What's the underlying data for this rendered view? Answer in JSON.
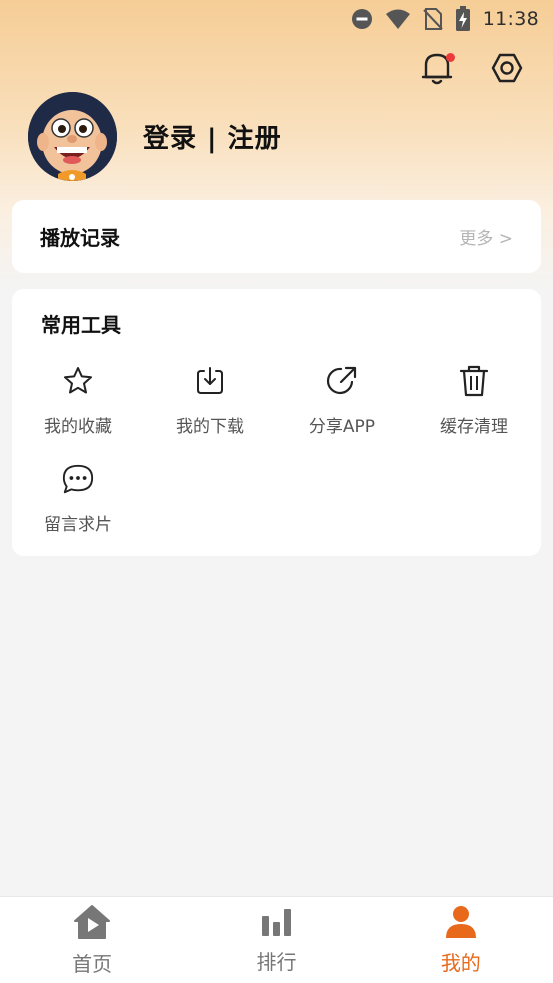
{
  "status_bar": {
    "time": "11:38",
    "icons": [
      "dnd-icon",
      "wifi-icon",
      "no-sim-icon",
      "battery-charging-icon"
    ]
  },
  "header": {
    "icons": [
      "bell-icon",
      "settings-icon"
    ],
    "has_notification": true
  },
  "profile": {
    "login_label": "登录 | 注册"
  },
  "history": {
    "title": "播放记录",
    "more_label": "更多 >"
  },
  "tools": {
    "title": "常用工具",
    "items": [
      {
        "label": "我的收藏",
        "icon": "star-icon"
      },
      {
        "label": "我的下载",
        "icon": "download-icon"
      },
      {
        "label": "分享APP",
        "icon": "share-icon"
      },
      {
        "label": "缓存清理",
        "icon": "trash-icon"
      },
      {
        "label": "留言求片",
        "icon": "message-icon"
      }
    ]
  },
  "bottom_nav": {
    "items": [
      {
        "label": "首页",
        "icon": "home-play-icon",
        "active": false
      },
      {
        "label": "排行",
        "icon": "bar-chart-icon",
        "active": false
      },
      {
        "label": "我的",
        "icon": "user-icon",
        "active": true
      }
    ],
    "active_color": "#e8691c",
    "inactive_color": "#777777"
  },
  "colors": {
    "accent": "#e8691c",
    "header_gradient_top": "#f6cd96",
    "notification_dot": "#ec3a3a"
  }
}
